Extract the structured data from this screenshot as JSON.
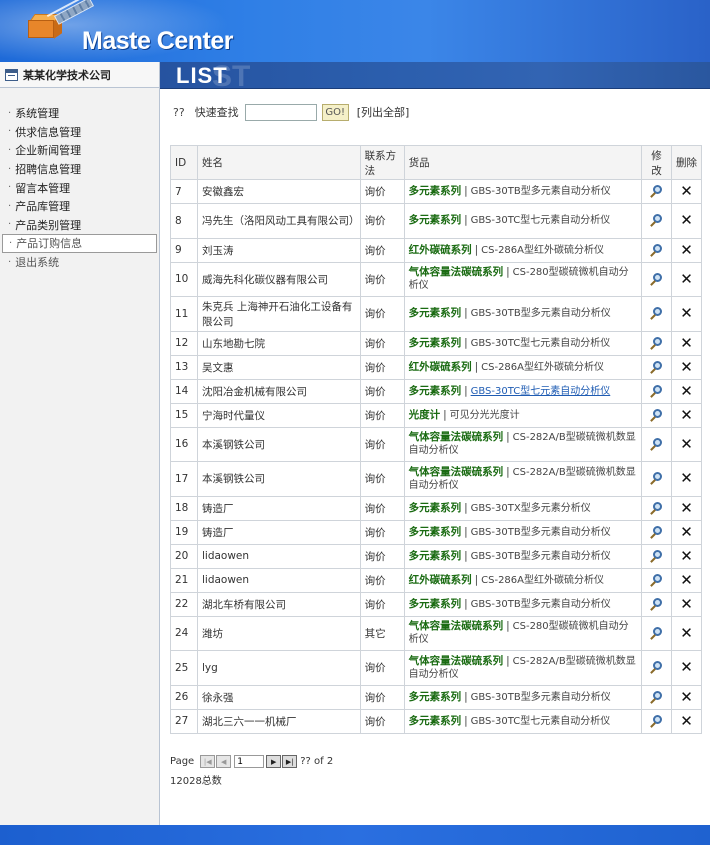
{
  "header": {
    "brand": "Maste Center"
  },
  "sidebar": {
    "company": "某某化学技术公司",
    "items": [
      {
        "label": "系统管理"
      },
      {
        "label": "供求信息管理"
      },
      {
        "label": "企业新闻管理"
      },
      {
        "label": "招聘信息管理"
      },
      {
        "label": "留言本管理"
      },
      {
        "label": "产品库管理"
      },
      {
        "label": "产品类别管理"
      },
      {
        "label": "产品订购信息"
      },
      {
        "label": "退出系统"
      }
    ]
  },
  "main": {
    "banner_title": "LIST",
    "banner_ghost": "ST",
    "search": {
      "prefix": "??",
      "label": "快速查找",
      "value": "",
      "go_label": "GO!",
      "list_all": "[列出全部]"
    },
    "table": {
      "headers": {
        "id": "ID",
        "name": "姓名",
        "contact": "联系方法",
        "goods": "货品",
        "edit": "修改",
        "del": "删除"
      },
      "rows": [
        {
          "id": "7",
          "name": "安徽鑫宏",
          "contact": "询价",
          "category": "多元素系列",
          "product": "GBS-30TB型多元素自动分析仪"
        },
        {
          "id": "8",
          "name": "冯先生（洛阳风动工具有限公司）",
          "contact": "询价",
          "category": "多元素系列",
          "product": "GBS-30TC型七元素自动分析仪"
        },
        {
          "id": "9",
          "name": "刘玉涛",
          "contact": "询价",
          "category": "红外碳硫系列",
          "product": "CS-286A型红外碳硫分析仪"
        },
        {
          "id": "10",
          "name": "威海先科化碳仪器有限公司",
          "contact": "询价",
          "category": "气体容量法碳硫系列",
          "product": "CS-280型碳硫微机自动分析仪"
        },
        {
          "id": "11",
          "name": "朱克兵 上海神开石油化工设备有限公司",
          "contact": "询价",
          "category": "多元素系列",
          "product": "GBS-30TB型多元素自动分析仪"
        },
        {
          "id": "12",
          "name": "山东地勘七院",
          "contact": "询价",
          "category": "多元素系列",
          "product": "GBS-30TC型七元素自动分析仪"
        },
        {
          "id": "13",
          "name": "吴文惠",
          "contact": "询价",
          "category": "红外碳硫系列",
          "product": "CS-286A型红外碳硫分析仪"
        },
        {
          "id": "14",
          "name": "沈阳冶金机械有限公司",
          "contact": "询价",
          "category": "多元素系列",
          "product": "GBS-30TC型七元素自动分析仪",
          "link": true
        },
        {
          "id": "15",
          "name": "宁海时代量仪",
          "contact": "询价",
          "category": "光度计",
          "product": "可见分光光度计"
        },
        {
          "id": "16",
          "name": "本溪钢铁公司",
          "contact": "询价",
          "category": "气体容量法碳硫系列",
          "product": "CS-282A/B型碳硫微机数显自动分析仪"
        },
        {
          "id": "17",
          "name": "本溪钢铁公司",
          "contact": "询价",
          "category": "气体容量法碳硫系列",
          "product": "CS-282A/B型碳硫微机数显自动分析仪"
        },
        {
          "id": "18",
          "name": "铸造厂",
          "contact": "询价",
          "category": "多元素系列",
          "product": "GBS-30TX型多元素分析仪"
        },
        {
          "id": "19",
          "name": "铸造厂",
          "contact": "询价",
          "category": "多元素系列",
          "product": "GBS-30TB型多元素自动分析仪"
        },
        {
          "id": "20",
          "name": "lidaowen",
          "contact": "询价",
          "category": "多元素系列",
          "product": "GBS-30TB型多元素自动分析仪"
        },
        {
          "id": "21",
          "name": "lidaowen",
          "contact": "询价",
          "category": "红外碳硫系列",
          "product": "CS-286A型红外碳硫分析仪"
        },
        {
          "id": "22",
          "name": "湖北车桥有限公司",
          "contact": "询价",
          "category": "多元素系列",
          "product": "GBS-30TB型多元素自动分析仪"
        },
        {
          "id": "24",
          "name": "潍坊",
          "contact": "其它",
          "category": "气体容量法碳硫系列",
          "product": "CS-280型碳硫微机自动分析仪"
        },
        {
          "id": "25",
          "name": "lyg",
          "contact": "询价",
          "category": "气体容量法碳硫系列",
          "product": "CS-282A/B型碳硫微机数显自动分析仪"
        },
        {
          "id": "26",
          "name": "徐永强",
          "contact": "询价",
          "category": "多元素系列",
          "product": "GBS-30TB型多元素自动分析仪"
        },
        {
          "id": "27",
          "name": "湖北三六一一机械厂",
          "contact": "询价",
          "category": "多元素系列",
          "product": "GBS-30TC型七元素自动分析仪"
        }
      ]
    },
    "pager": {
      "label": "Page",
      "page_value": "1",
      "of_text": "?? of 2",
      "total_text": "12028总数"
    }
  },
  "colors": {
    "brand_blue": "#2f7fe6",
    "category_green": "#1a6b12",
    "link_blue": "#1f5cb3"
  }
}
